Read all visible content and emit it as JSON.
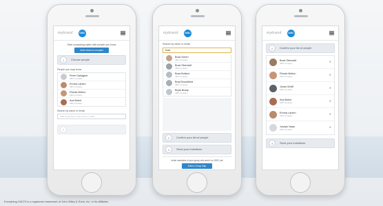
{
  "brand": {
    "logo_text": "mybrand",
    "badge_text": "DISC",
    "accent": "#1b8ad6"
  },
  "phone1": {
    "intro": "Start comparing styles with people you know",
    "intro_button": "Invite others to compare",
    "step1_number": "1",
    "step1_label": "Choose people",
    "people_label": "People you may know",
    "people": [
      {
        "name": "Peter Gallagher",
        "company": "ABC Company"
      },
      {
        "name": "Emma Larsen",
        "company": "ABC Company"
      },
      {
        "name": "Rhoda Mellon",
        "company": "ABC Company"
      },
      {
        "name": "Ava Bobol",
        "company": "ABC Company"
      }
    ],
    "search_label": "Search by name or email",
    "search_placeholder": "Start typing first or last name or email"
  },
  "phone2": {
    "search_label": "Search by name or email",
    "search_value": "brad",
    "results": [
      {
        "name": "Brad Green",
        "company": "ABC Company"
      },
      {
        "name": "Brad Oberwelt",
        "company": "ABC Company"
      },
      {
        "name": "Brad Bollard",
        "company": "ABC Company"
      },
      {
        "name": "Brad Brookfield",
        "company": "ABC Company"
      },
      {
        "name": "Bryla Brady",
        "company": "ABC Company"
      }
    ],
    "step2_number": "2",
    "step2_label": "Confirm your list of people",
    "step3_number": "3",
    "step3_label": "Send your invitations",
    "bottom_text": "Invite members of your group who aren't on DISC yet",
    "bottom_button": "Build a Group Map"
  },
  "phone3": {
    "step2_number": "2",
    "step2_label": "Confirm your list of people",
    "people": [
      {
        "name": "Brad Oberwelt",
        "company": "ABC Company"
      },
      {
        "name": "Rhoda Mellon",
        "company": "ABC Company"
      },
      {
        "name": "Jonas Wolff",
        "company": "ABC Company"
      },
      {
        "name": "Ava Bobol",
        "company": "ABC Company"
      },
      {
        "name": "Emma Larsen",
        "company": "ABC Company"
      },
      {
        "name": "Joseph Naas",
        "company": "ABC Company"
      }
    ],
    "step3_number": "3",
    "step3_label": "Send your invitations"
  },
  "footer": "Everything DiSC® is a registered trademark of John Wiley & Sons, Inc. or its affiliates."
}
